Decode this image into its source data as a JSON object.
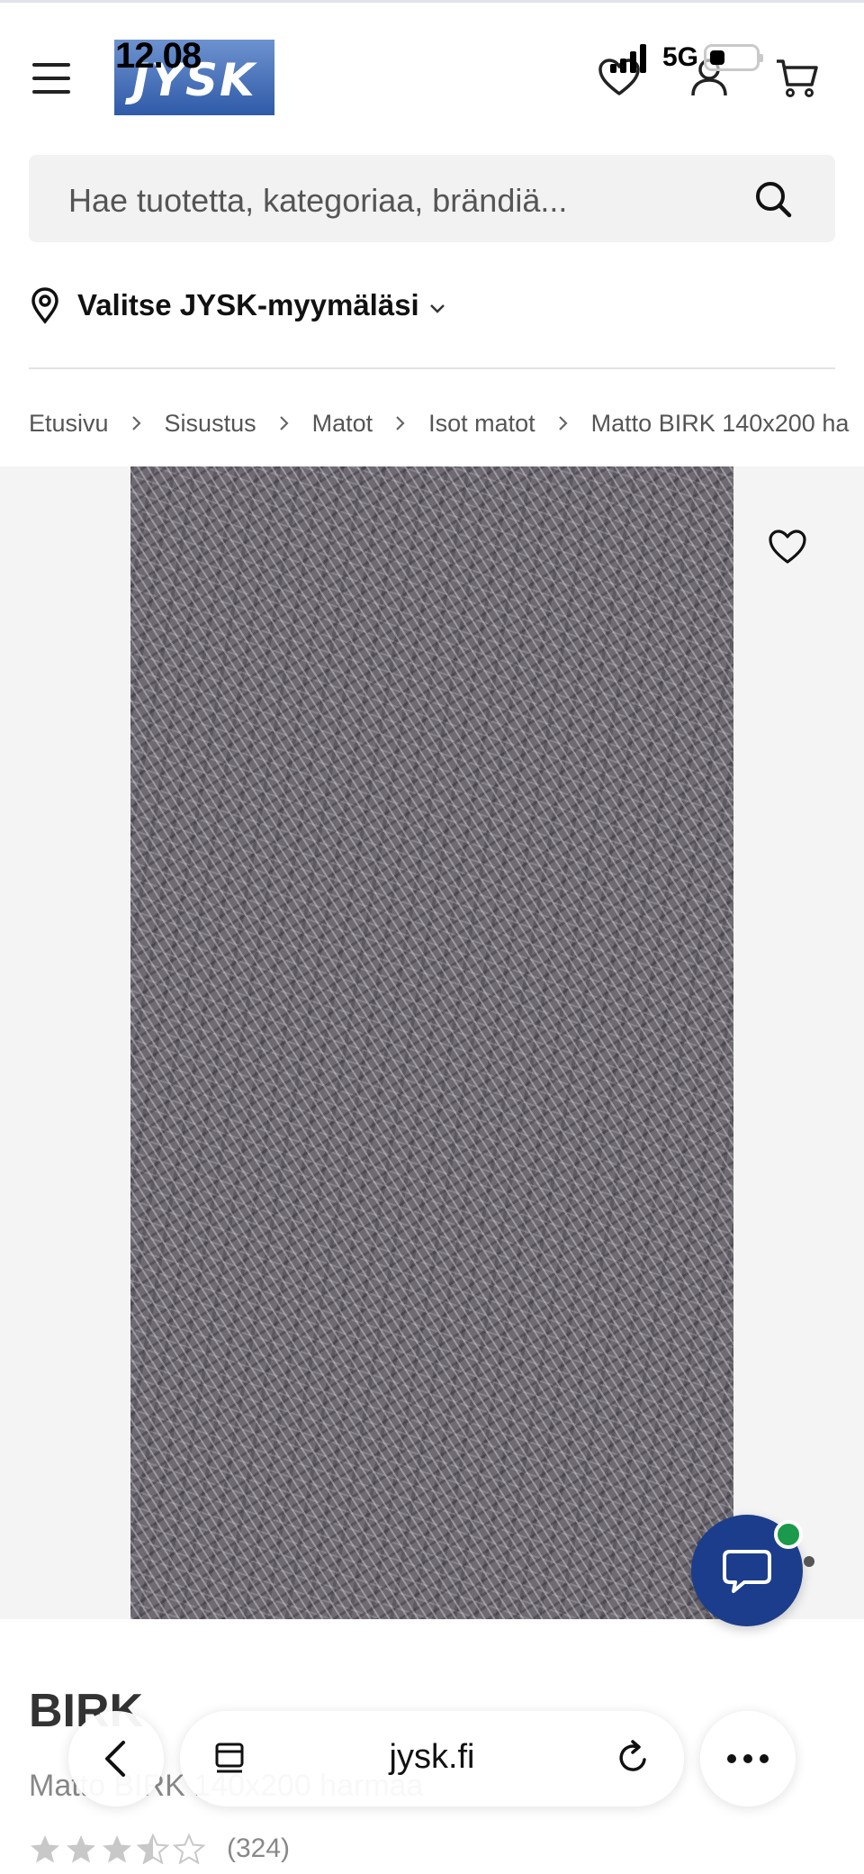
{
  "status_bar": {
    "time": "12.08",
    "network": "5G"
  },
  "header": {
    "logo_text": "JYSK",
    "colors": {
      "logo_top": "#6d92cf",
      "logo_bottom": "#2f5aa8"
    }
  },
  "search": {
    "placeholder": "Hae tuotetta, kategoriaa, brändiä..."
  },
  "store": {
    "label": "Valitse JYSK-myymäläsi"
  },
  "breadcrumb": {
    "items": [
      "Etusivu",
      "Sisustus",
      "Matot",
      "Isot matot",
      "Matto BIRK 140x200 ha"
    ]
  },
  "product": {
    "title": "BIRK",
    "subtitle": "Matto BIRK 140x200 harmaa",
    "rating": 3.5,
    "rating_max": 5,
    "review_count": "(324)"
  },
  "chat": {
    "colors": {
      "button": "#1c3d8c",
      "online": "#1a9a4a"
    }
  },
  "browser": {
    "url": "jysk.fi"
  }
}
